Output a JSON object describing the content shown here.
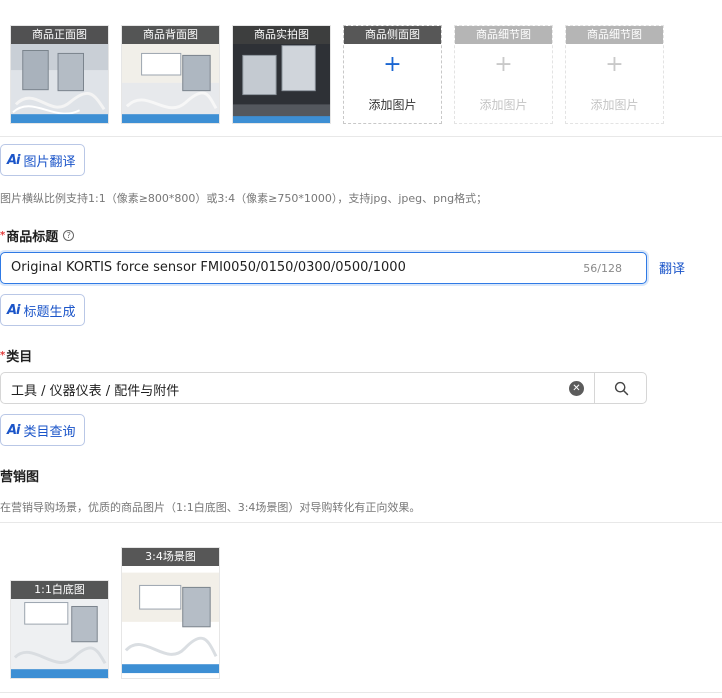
{
  "image_slots": [
    {
      "label": "商品正面图",
      "type": "photo"
    },
    {
      "label": "商品背面图",
      "type": "photo"
    },
    {
      "label": "商品实拍图",
      "type": "photo"
    },
    {
      "label": "商品侧面图",
      "type": "add",
      "add_text": "添加图片",
      "plus": "+"
    },
    {
      "label": "商品细节图",
      "type": "disabled",
      "add_text": "添加图片",
      "plus": "+"
    },
    {
      "label": "商品细节图",
      "type": "disabled",
      "add_text": "添加图片",
      "plus": "+"
    }
  ],
  "image_translate_button": {
    "icon": "Ai",
    "label": "图片翻译"
  },
  "image_hint": "图片横纵比例支持1:1（像素≥800*800）或3:4（像素≥750*1000），支持jpg、jpeg、png格式；",
  "title_field": {
    "label": "商品标题",
    "value": "Original KORTIS force sensor FMI0050/0150/0300/0500/1000",
    "counter": "56/128",
    "translate_link": "翻译"
  },
  "title_generate_button": {
    "icon": "Ai",
    "label": "标题生成"
  },
  "category_field": {
    "label": "类目",
    "value": "工具 / 仪器仪表 / 配件与附件"
  },
  "category_query_button": {
    "icon": "Ai",
    "label": "类目查询"
  },
  "marketing": {
    "title": "营销图",
    "hint": "在营销导购场景，优质的商品图片（1:1白底图、3:4场景图）对导购转化有正向效果。",
    "slots": [
      {
        "label": "1:1白底图"
      },
      {
        "label": "3:4场景图"
      }
    ]
  },
  "colors": {
    "accent": "#1b55c9",
    "focus_border": "#2f7ae5",
    "required": "#e03a3a"
  }
}
